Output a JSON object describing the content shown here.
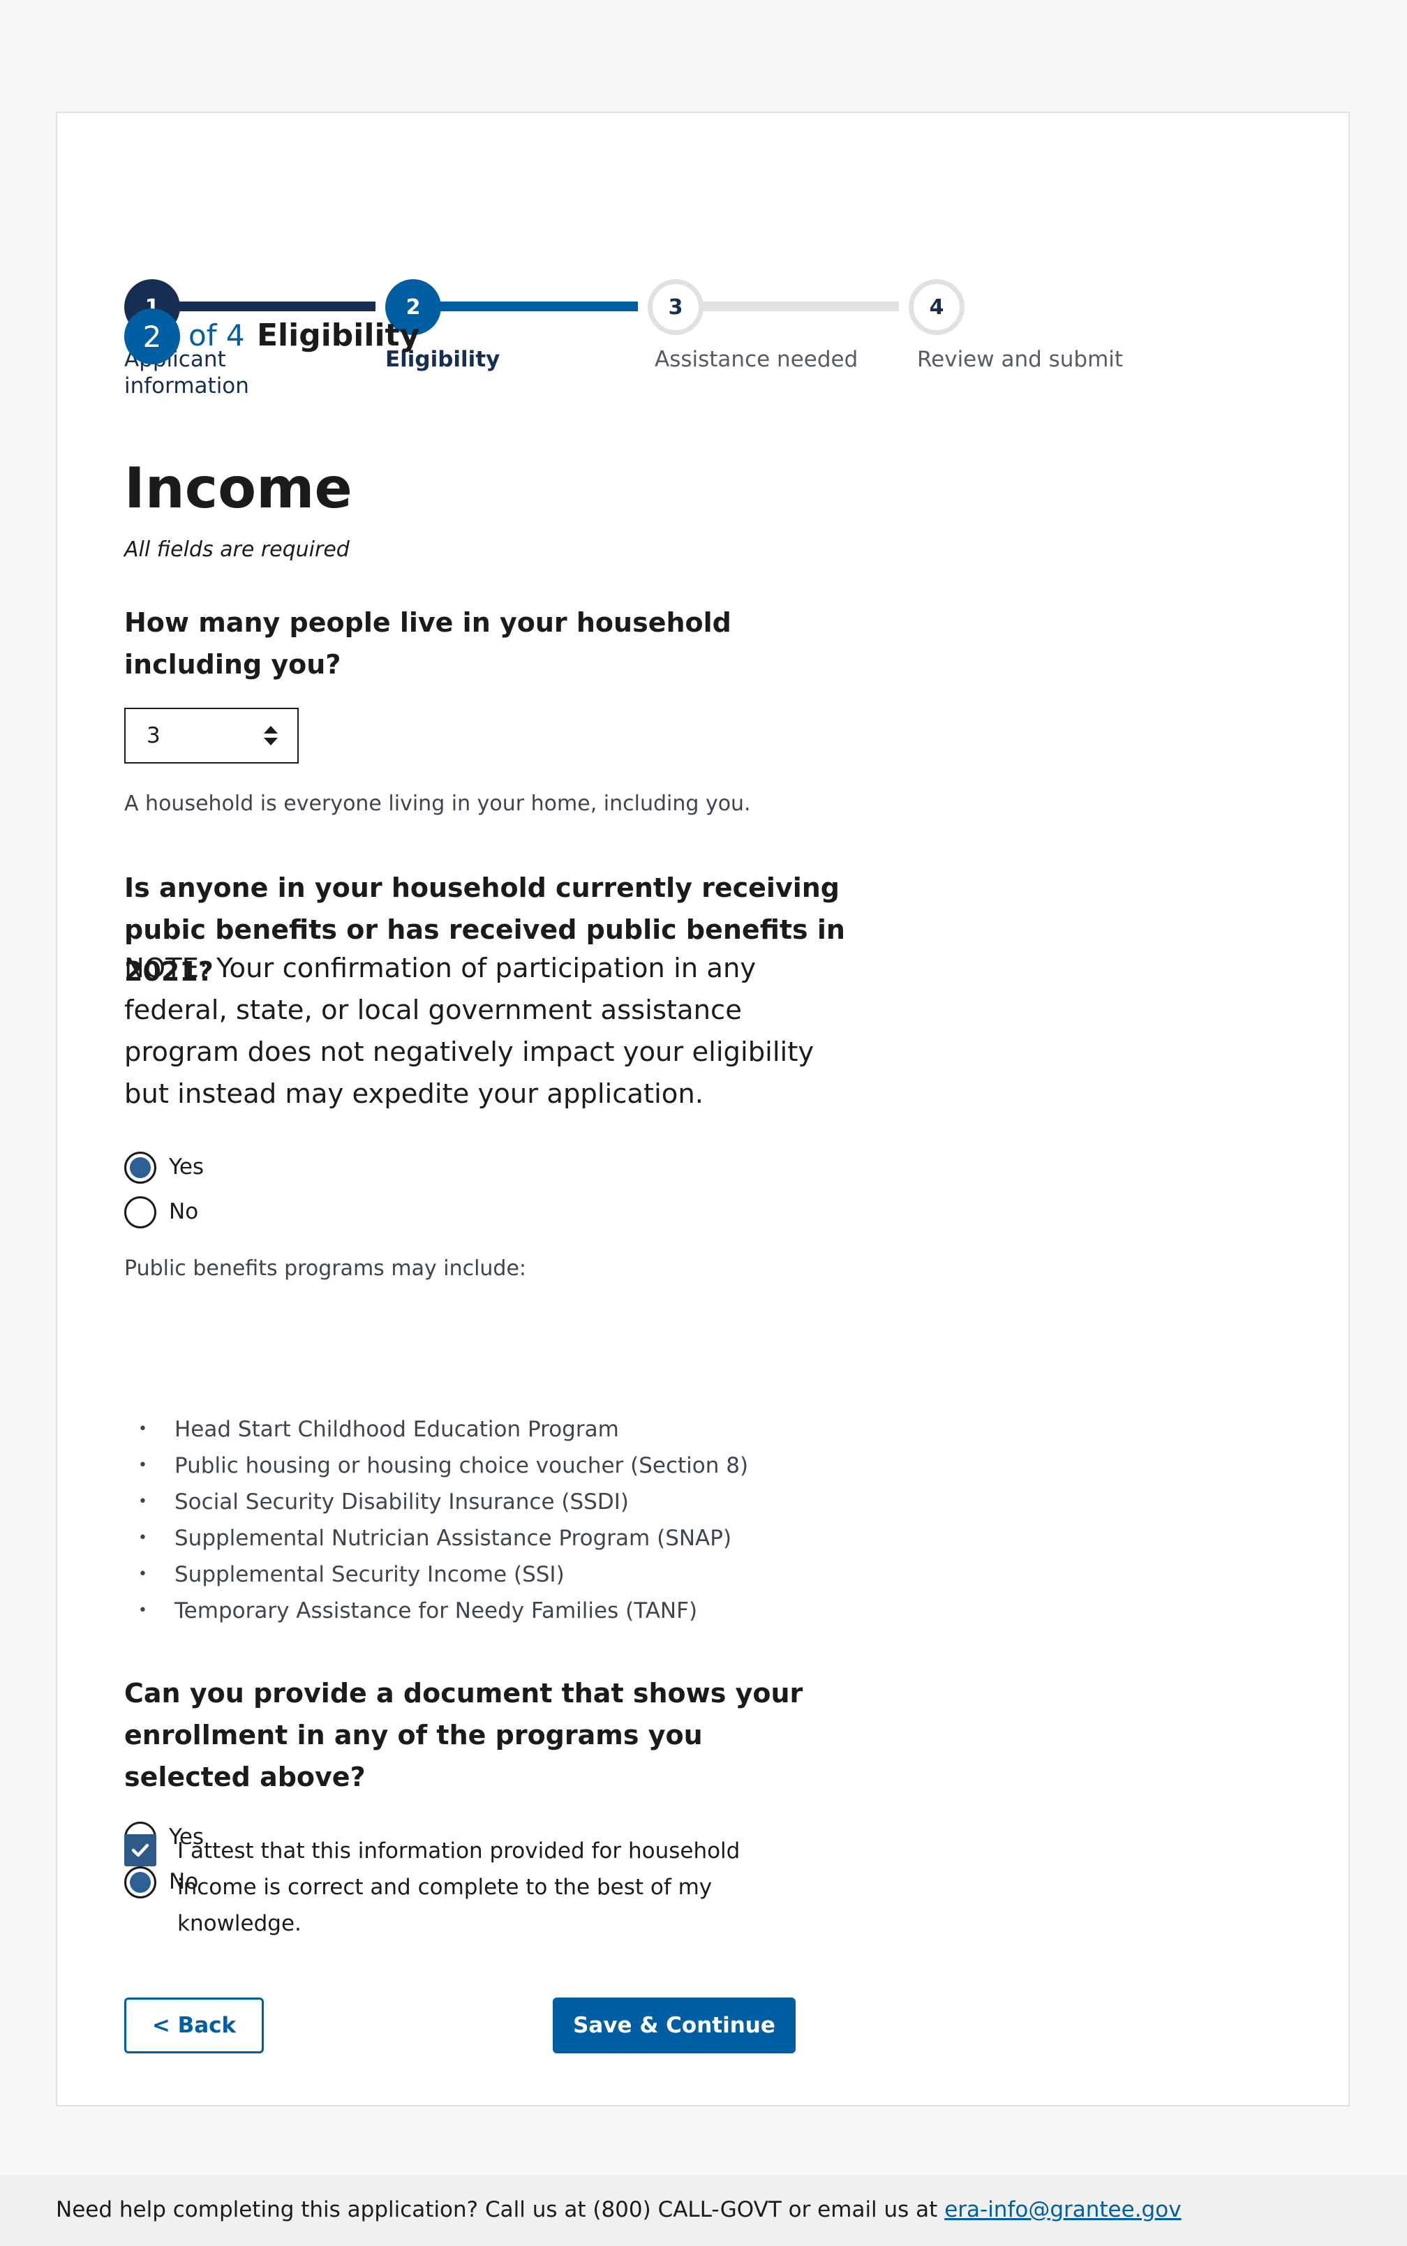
{
  "steps": [
    {
      "number": "1",
      "label": "Applicant information",
      "state": "complete"
    },
    {
      "number": "2",
      "label": "Eligibility",
      "state": "current"
    },
    {
      "number": "3",
      "label": "Assistance needed",
      "state": "upcoming"
    },
    {
      "number": "4",
      "label": "Review and submit",
      "state": "upcoming"
    }
  ],
  "step_counter": {
    "current": "2",
    "of_text": "of 4",
    "heading": "Eligibility"
  },
  "page": {
    "title": "Income",
    "required_note": "All fields are required"
  },
  "household": {
    "question": "How many people live in your household including you?",
    "value": "3",
    "hint": "A household is everyone living in your home, including you."
  },
  "benefits": {
    "question": "Is anyone in your household currently receiving pubic benefits or has received public benefits in 2021?",
    "note": "NOTE: Your confirmation of participation in any federal, state, or local government assistance program does not negatively impact your eligibility but instead may expedite your application.",
    "options": [
      {
        "label": "Yes",
        "selected": true
      },
      {
        "label": "No",
        "selected": false
      }
    ],
    "list_intro": "Public benefits programs may include:",
    "programs": [
      "Head Start Childhood Education Program",
      "Public housing or housing choice voucher (Section 8)",
      "Social Security Disability Insurance (SSDI)",
      "Supplemental Nutrician Assistance Program (SNAP)",
      "Supplemental Security Income (SSI)",
      "Temporary Assistance for Needy Families (TANF)"
    ]
  },
  "document": {
    "question": "Can you provide a document that shows your enrollment in any of the programs you selected above?",
    "options": [
      {
        "label": "Yes",
        "selected": false
      },
      {
        "label": "No",
        "selected": true
      }
    ]
  },
  "attestation": {
    "checked": true,
    "text": "I attest that this information provided for household income is correct and complete to the best of my knowledge."
  },
  "buttons": {
    "back": "< Back",
    "save": "Save & Continue"
  },
  "footer": {
    "text": "Need help completing this application? Call us at (800) CALL-GOVT or email us at ",
    "email": "era-info@grantee.gov"
  },
  "colors": {
    "primary": "#005ea2",
    "complete": "#162e51",
    "upcoming": "#dfe1e2",
    "radio_selected": "#2e6097"
  }
}
